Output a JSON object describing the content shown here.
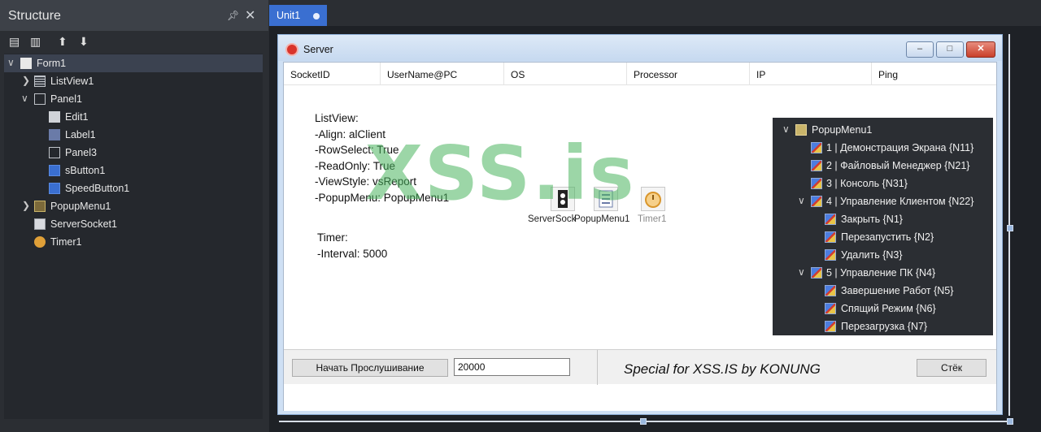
{
  "structure": {
    "title": "Structure",
    "pin_icon": "pin-icon",
    "close_icon": "close-icon",
    "toolbar": {
      "icons": [
        "expand-folder-icon",
        "collapse-folder-icon",
        "arrow-up-icon",
        "arrow-down-icon"
      ]
    },
    "tree": [
      {
        "label": "Form1",
        "icon": "form-icon"
      },
      {
        "label": "ListView1",
        "icon": "listview-icon"
      },
      {
        "label": "Panel1",
        "icon": "panel-icon"
      },
      {
        "label": "Edit1",
        "icon": "edit-icon"
      },
      {
        "label": "Label1",
        "icon": "label-icon"
      },
      {
        "label": "Panel3",
        "icon": "panel-icon"
      },
      {
        "label": "sButton1",
        "icon": "button-icon"
      },
      {
        "label": "SpeedButton1",
        "icon": "speedbutton-icon"
      },
      {
        "label": "PopupMenu1",
        "icon": "popupmenu-icon"
      },
      {
        "label": "ServerSocket1",
        "icon": "serversocket-icon"
      },
      {
        "label": "Timer1",
        "icon": "timer-icon"
      }
    ]
  },
  "editor": {
    "tab_label": "Unit1",
    "accent": "#3a6fd1"
  },
  "form": {
    "title": "Server",
    "listview": {
      "columns": [
        "SocketID",
        "UserName@PC",
        "OS",
        "Processor",
        "IP",
        "Ping"
      ]
    },
    "notes": {
      "listview": "ListView:\n-Align: alClient\n-RowSelect: True\n-ReadOnly: True\n-ViewStyle: vsReport\n-PopupMenu: PopupMenu1",
      "timer": "Timer:\n-Interval: 5000"
    },
    "components": [
      {
        "label": "ServerSock",
        "icon": "serversocket-icon"
      },
      {
        "label": "PopupMenu1",
        "icon": "popupmenu-icon"
      },
      {
        "label": "Timer1",
        "icon": "timer-icon"
      }
    ],
    "popup_menu": {
      "root": "PopupMenu1",
      "items": [
        "1 | Демонстрация Экрана {N11}",
        "2 | Файловый Менеджер {N21}",
        "3 | Консоль {N31}",
        "4 | Управление Клиентом {N22}",
        "Закрыть {N1}",
        "Перезапустить {N2}",
        "Удалить {N3}",
        "5 | Управление ПК {N4}",
        "Завершение Работ {N5}",
        "Спящий Режим {N6}",
        "Перезагрузка {N7}"
      ]
    },
    "bottom": {
      "start_button": "Начать Прослушивание",
      "port_value": "20000",
      "signature": "Special for XSS.IS by KONUNG",
      "stop_button": "Стёк"
    }
  },
  "watermark": "XSS.is"
}
